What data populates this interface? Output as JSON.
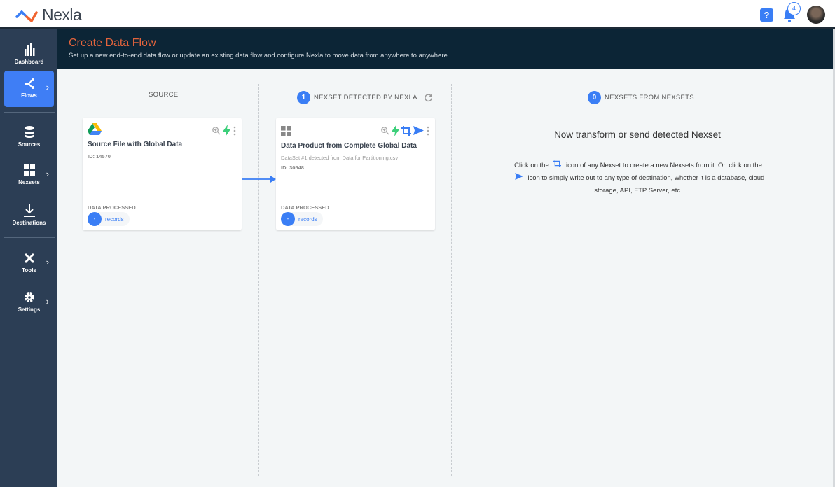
{
  "app": {
    "name": "Nexla",
    "brand_color": "#3a7ef5",
    "accent_color": "#e4643c"
  },
  "topbar": {
    "help_icon": "question-icon",
    "notification_count": "4"
  },
  "sidebar": {
    "items": [
      {
        "label": "Dashboard",
        "icon": "bar-chart-icon"
      },
      {
        "label": "Flows",
        "icon": "flow-icon",
        "active": true
      },
      {
        "label": "Sources",
        "icon": "database-icon"
      },
      {
        "label": "Nexsets",
        "icon": "grid-icon"
      },
      {
        "label": "Destinations",
        "icon": "download-icon"
      },
      {
        "label": "Tools",
        "icon": "tools-icon"
      },
      {
        "label": "Settings",
        "icon": "gear-icon"
      }
    ]
  },
  "header": {
    "title": "Create Data Flow",
    "subtitle": "Set up a new end-to-end data flow or update an existing data flow and configure Nexla to move data from anywhere to anywhere."
  },
  "columns": {
    "source": {
      "heading": "SOURCE"
    },
    "detected": {
      "count": "1",
      "heading": "NEXSET DETECTED BY NEXLA"
    },
    "derived": {
      "count": "0",
      "heading": "NEXSETS FROM NEXSETS"
    }
  },
  "source_card": {
    "title": "Source File with Global Data",
    "id": "ID: 14570",
    "data_processed_label": "DATA PROCESSED",
    "records_value": "-",
    "records_label": "records"
  },
  "nexset_card": {
    "title": "Data Product from Complete Global Data",
    "subtitle": "DataSet #1 detected from Data for Partitioning.csv",
    "id": "ID: 30548",
    "data_processed_label": "DATA PROCESSED",
    "records_value": "-",
    "records_label": "records"
  },
  "empty_state": {
    "heading": "Now transform or send detected Nexset",
    "text_1": "Click on the",
    "text_2": "icon of any Nexset to create a new Nexsets from it. Or, click on the",
    "text_3": "icon to simply write out to any type of destination, whether it is a database, cloud storage, API, FTP Server, etc."
  }
}
